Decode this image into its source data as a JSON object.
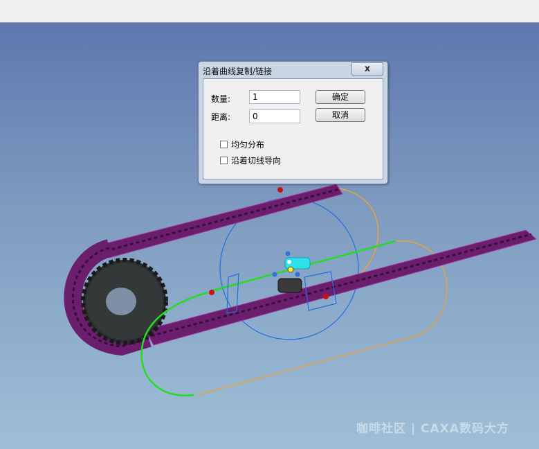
{
  "dialog": {
    "title": "沿着曲线复制/链接",
    "close_glyph": "x",
    "count_label": "数量:",
    "count_value": "1",
    "distance_label": "距离:",
    "distance_value": "0",
    "ok_label": "确定",
    "cancel_label": "取消",
    "checkbox_even_label": "均匀分布",
    "checkbox_even_checked": false,
    "checkbox_tangent_label": "沿着切线导向",
    "checkbox_tangent_checked": false
  },
  "watermark": "咖啡社区 | CAXA数码大方",
  "colors": {
    "viewport_top": "#5e77b0",
    "viewport_bottom": "#9fbfd7",
    "chain": "#6b1e6e",
    "sprocket": "#2d3030",
    "path_green": "#22dd22",
    "path_orange": "#e8a040",
    "circle_blue": "#1e6fe0",
    "handle_red": "#cc1111"
  }
}
